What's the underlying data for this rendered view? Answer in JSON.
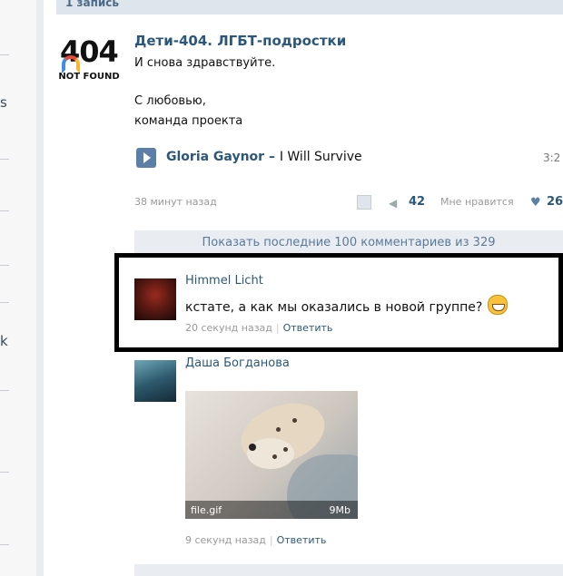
{
  "header": {
    "partial_label": "1 запись"
  },
  "left_sidebar": {
    "fragments": [
      "s",
      "k"
    ]
  },
  "post": {
    "avatar": {
      "big_text": "404",
      "small_text": "NOT FOUND"
    },
    "author": "Дети-404. ЛГБТ-подростки",
    "lines": [
      "И снова здравствуйте.",
      "С любовью,",
      "команда проекта"
    ],
    "audio": {
      "artist": "Gloria Gaynor",
      "separator": "–",
      "title": "I Will Survive",
      "duration": "3:2"
    },
    "time": "38 минут назад",
    "shares": "42",
    "like_label": "Мне нравится",
    "likes": "26",
    "icons": {
      "share": "share-icon",
      "megaphone": "megaphone-icon",
      "heart": "heart-icon",
      "play": "play-icon"
    }
  },
  "comments_toggle": "Показать последние 100 комментариев из 329",
  "comments": [
    {
      "author": "Himmel Licht",
      "text": "кстате, а как мы оказались в новой группе?",
      "time": "20 секунд назад",
      "reply": "Ответить",
      "avatar_color": "#5a1a12",
      "highlighted": true
    },
    {
      "author": "Даша Богданова",
      "time": "9 секунд назад",
      "reply": "Ответить",
      "avatar_color": "#2e5a6e",
      "attachment": {
        "filename": "file.gif",
        "size": "9Mb"
      }
    }
  ],
  "colors": {
    "link": "#2b587a",
    "highlight_border": "#000000",
    "page_bg": "#e9edf1"
  }
}
